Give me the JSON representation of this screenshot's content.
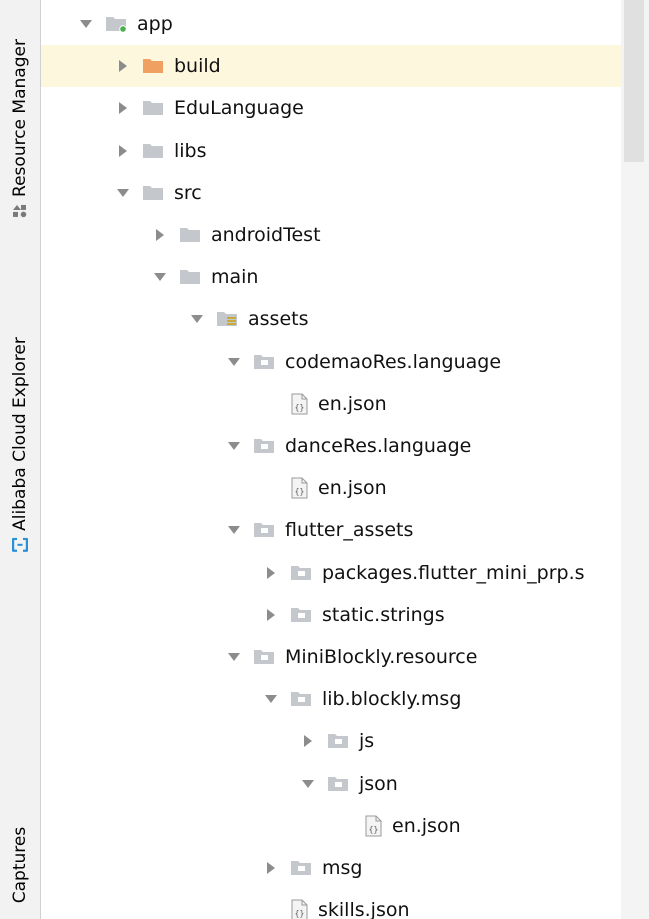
{
  "sidebar": {
    "tabs": [
      {
        "label": "Resource Manager",
        "icon": "resource-manager-icon"
      },
      {
        "label": "Alibaba Cloud Explorer",
        "icon": "alibaba-cloud-icon"
      },
      {
        "label": "Captures",
        "icon": ""
      }
    ]
  },
  "colors": {
    "folder": "#c4c8cd",
    "build_folder": "#f0a060",
    "selected_row": "#fdf8dd",
    "arrow": "#8c8c8c",
    "module_dot": "#4caf50",
    "resource_blue": "#2a8fd9"
  },
  "tree": [
    {
      "label": "app",
      "depth": 0,
      "state": "expanded",
      "icon": "module-folder-icon"
    },
    {
      "label": "build",
      "depth": 1,
      "state": "collapsed",
      "icon": "build-folder-icon",
      "selected": true
    },
    {
      "label": "EduLanguage",
      "depth": 1,
      "state": "collapsed",
      "icon": "folder-icon"
    },
    {
      "label": "libs",
      "depth": 1,
      "state": "collapsed",
      "icon": "folder-icon"
    },
    {
      "label": "src",
      "depth": 1,
      "state": "expanded",
      "icon": "folder-icon"
    },
    {
      "label": "androidTest",
      "depth": 2,
      "state": "collapsed",
      "icon": "folder-icon"
    },
    {
      "label": "main",
      "depth": 2,
      "state": "expanded",
      "icon": "folder-icon"
    },
    {
      "label": "assets",
      "depth": 3,
      "state": "expanded",
      "icon": "assets-folder-icon"
    },
    {
      "label": "codemaoRes.language",
      "depth": 4,
      "state": "expanded",
      "icon": "package-folder-icon"
    },
    {
      "label": "en.json",
      "depth": 5,
      "state": "leaf",
      "icon": "json-file-icon"
    },
    {
      "label": "danceRes.language",
      "depth": 4,
      "state": "expanded",
      "icon": "package-folder-icon"
    },
    {
      "label": "en.json",
      "depth": 5,
      "state": "leaf",
      "icon": "json-file-icon"
    },
    {
      "label": "flutter_assets",
      "depth": 4,
      "state": "expanded",
      "icon": "package-folder-icon"
    },
    {
      "label": "packages.flutter_mini_prp.s",
      "depth": 5,
      "state": "collapsed",
      "icon": "package-folder-icon"
    },
    {
      "label": "static.strings",
      "depth": 5,
      "state": "collapsed",
      "icon": "package-folder-icon"
    },
    {
      "label": "MiniBlockly.resource",
      "depth": 4,
      "state": "expanded",
      "icon": "package-folder-icon"
    },
    {
      "label": "lib.blockly.msg",
      "depth": 5,
      "state": "expanded",
      "icon": "package-folder-icon"
    },
    {
      "label": "js",
      "depth": 6,
      "state": "collapsed",
      "icon": "package-folder-icon"
    },
    {
      "label": "json",
      "depth": 6,
      "state": "expanded",
      "icon": "package-folder-icon"
    },
    {
      "label": "en.json",
      "depth": 7,
      "state": "leaf",
      "icon": "json-file-icon"
    },
    {
      "label": "msg",
      "depth": 5,
      "state": "collapsed",
      "icon": "package-folder-icon"
    },
    {
      "label": "skills.json",
      "depth": 5,
      "state": "leaf-partial",
      "icon": "json-file-icon"
    }
  ]
}
